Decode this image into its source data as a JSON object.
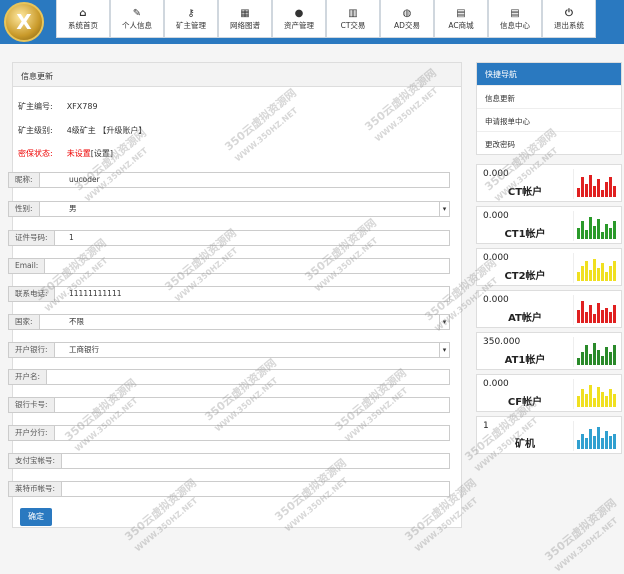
{
  "nav": [
    {
      "label": "系统首页",
      "icon": "home-icon",
      "glyph": "⌂"
    },
    {
      "label": "个人信息",
      "icon": "edit-icon",
      "glyph": "✎"
    },
    {
      "label": "矿主管理",
      "icon": "key-icon",
      "glyph": "⚷"
    },
    {
      "label": "网络图谱",
      "icon": "sitemap-icon",
      "glyph": "▦"
    },
    {
      "label": "资产管理",
      "icon": "user-icon",
      "glyph": "●"
    },
    {
      "label": "CT交易",
      "icon": "bar-chart-icon",
      "glyph": "▥"
    },
    {
      "label": "AD交易",
      "icon": "dashboard-icon",
      "glyph": "◍"
    },
    {
      "label": "AC商城",
      "icon": "calendar-icon",
      "glyph": "▤"
    },
    {
      "label": "信息中心",
      "icon": "calendar-icon",
      "glyph": "▤"
    },
    {
      "label": "退出系统",
      "icon": "power-icon",
      "glyph": "⏻"
    }
  ],
  "panel_title": "信息更新",
  "info": {
    "id_label": "矿主编号:",
    "id_value": "XFX789",
    "level_label": "矿主级别:",
    "level_value": "4级矿主 【升级账户】",
    "secret_label": "密保状态:",
    "secret_value": "未设置",
    "secret_link": "[设置]"
  },
  "fields": [
    {
      "label": "昵称:",
      "value": "uucoder",
      "select": false
    },
    {
      "label": "性别:",
      "value": "男",
      "select": true
    },
    {
      "label": "证件号码:",
      "value": "1",
      "select": false
    },
    {
      "label": "Email:",
      "value": "",
      "select": false
    },
    {
      "label": "联系电话:",
      "value": "11111111111",
      "select": false
    },
    {
      "label": "国家:",
      "value": "不限",
      "select": true
    },
    {
      "label": "开户银行:",
      "value": "工商银行",
      "select": true
    },
    {
      "label": "开户名:",
      "value": "",
      "select": false
    },
    {
      "label": "银行卡号:",
      "value": "",
      "select": false
    },
    {
      "label": "开户分行:",
      "value": "",
      "select": false
    },
    {
      "label": "支付宝帐号:",
      "value": "",
      "select": false
    },
    {
      "label": "莱特币帐号:",
      "value": "",
      "select": false
    }
  ],
  "confirm_label": "确定",
  "quick": {
    "title": "快捷导航",
    "items": [
      "信息更新",
      "申请报单中心",
      "更改密码"
    ]
  },
  "accounts": [
    {
      "value": "0.000",
      "name": "CT帐户",
      "color": "#e02020",
      "bars": [
        0.4,
        0.9,
        0.6,
        1,
        0.5,
        0.8,
        0.3,
        0.7,
        0.9,
        0.5
      ]
    },
    {
      "value": "0.000",
      "name": "CT1帐户",
      "color": "#2a9a2a",
      "bars": [
        0.5,
        0.8,
        0.4,
        1,
        0.6,
        0.9,
        0.3,
        0.7,
        0.5,
        0.8
      ]
    },
    {
      "value": "0.000",
      "name": "CT2帐户",
      "color": "#f0e020",
      "bars": [
        0.4,
        0.7,
        0.9,
        0.5,
        1,
        0.6,
        0.8,
        0.4,
        0.7,
        0.9
      ]
    },
    {
      "value": "0.000",
      "name": "AT帐户",
      "color": "#e02020",
      "bars": [
        0.6,
        1,
        0.5,
        0.8,
        0.4,
        0.9,
        0.6,
        0.7,
        0.5,
        0.8
      ]
    },
    {
      "value": "350.000",
      "name": "AT1帐户",
      "color": "#2a8a2a",
      "bars": [
        0.3,
        0.6,
        0.9,
        0.5,
        1,
        0.7,
        0.4,
        0.8,
        0.6,
        0.9
      ]
    },
    {
      "value": "0.000",
      "name": "CF帐户",
      "color": "#f0e020",
      "bars": [
        0.5,
        0.8,
        0.6,
        1,
        0.4,
        0.9,
        0.7,
        0.5,
        0.8,
        0.6
      ]
    },
    {
      "value": "1",
      "name": "矿机",
      "color": "#30a0d0",
      "bars": [
        0.4,
        0.7,
        0.5,
        0.9,
        0.6,
        1,
        0.5,
        0.8,
        0.6,
        0.7
      ]
    }
  ],
  "watermark": {
    "text": "350云虚拟资源网",
    "url": "WWW.350HZ.NET"
  }
}
